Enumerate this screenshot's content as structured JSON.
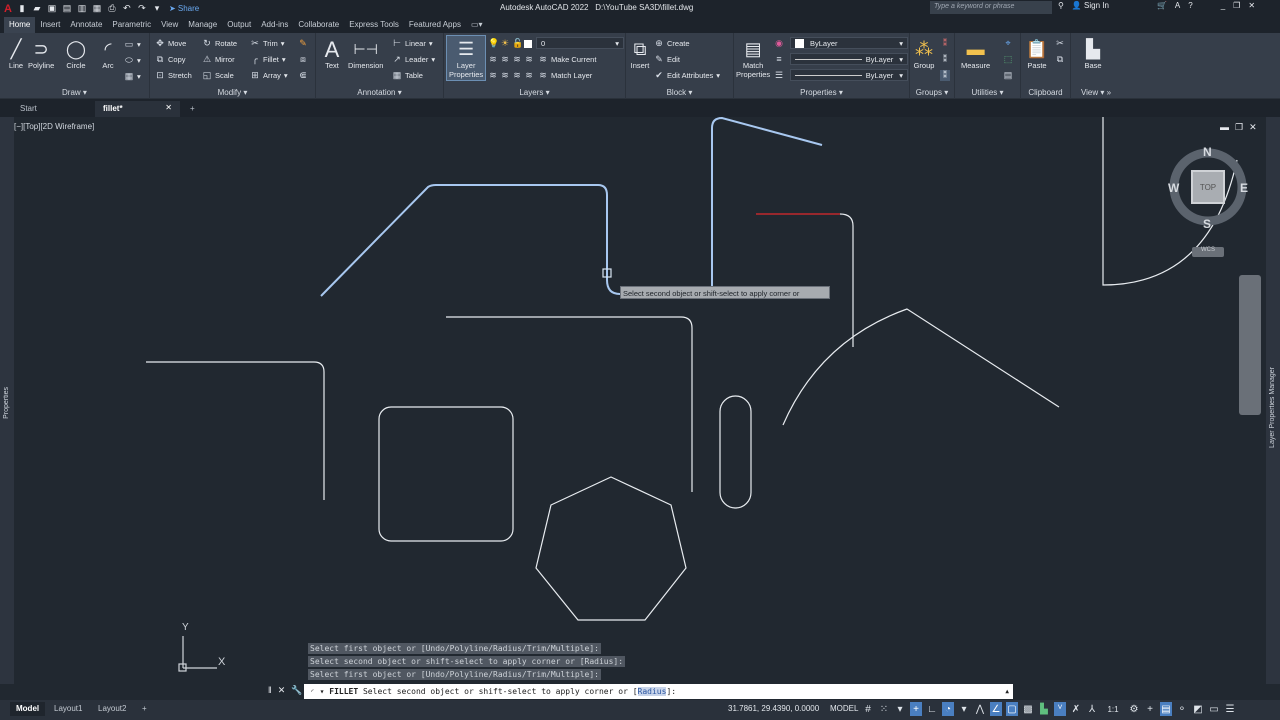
{
  "app": {
    "title": "Autodesk AutoCAD 2022",
    "file": "D:\\YouTube SA3D\\fillet.dwg",
    "share": "Share",
    "search_placeholder": "Type a keyword or phrase",
    "sign_in": "Sign In"
  },
  "ribbon_tabs": [
    "Home",
    "Insert",
    "Annotate",
    "Parametric",
    "View",
    "Manage",
    "Output",
    "Add-ins",
    "Collaborate",
    "Express Tools",
    "Featured Apps"
  ],
  "panels": {
    "draw": {
      "label": "Draw",
      "line": "Line",
      "polyline": "Polyline",
      "circle": "Circle",
      "arc": "Arc"
    },
    "modify": {
      "label": "Modify",
      "move": "Move",
      "rotate": "Rotate",
      "trim": "Trim",
      "copy": "Copy",
      "mirror": "Mirror",
      "fillet": "Fillet",
      "stretch": "Stretch",
      "scale": "Scale",
      "array": "Array"
    },
    "annotation": {
      "label": "Annotation",
      "text": "Text",
      "dimension": "Dimension",
      "linear": "Linear",
      "leader": "Leader",
      "table": "Table"
    },
    "layers": {
      "label": "Layers",
      "layer_properties_1": "Layer",
      "layer_properties_2": "Properties",
      "current_layer": "0",
      "make_current": "Make Current",
      "match_layer": "Match Layer"
    },
    "block": {
      "label": "Block",
      "insert": "Insert",
      "create": "Create",
      "edit": "Edit",
      "edit_attributes": "Edit Attributes"
    },
    "properties": {
      "label": "Properties",
      "match_1": "Match",
      "match_2": "Properties",
      "color": "ByLayer",
      "linetype": "ByLayer",
      "lineweight": "ByLayer"
    },
    "groups": {
      "label": "Groups",
      "group": "Group"
    },
    "utilities": {
      "label": "Utilities",
      "measure": "Measure"
    },
    "clipboard": {
      "label": "Clipboard",
      "paste": "Paste"
    },
    "view": {
      "label": "View",
      "base": "Base"
    }
  },
  "doc_tabs": {
    "start": "Start",
    "active": "fillet*"
  },
  "viewport": {
    "label": "[−][Top][2D Wireframe]"
  },
  "side_palettes": {
    "left": "Properties",
    "right": "Layer Properties Manager"
  },
  "viewcube": {
    "n": "N",
    "s": "S",
    "e": "E",
    "w": "W",
    "face": "TOP",
    "wcs": "WCS"
  },
  "tooltip": "Select second object or shift-select to apply corner or",
  "command_history": [
    "Select first object or [Undo/Polyline/Radius/Trim/Multiple]:",
    "Select second object or shift-select to apply corner or [Radius]:",
    "Select first object or [Undo/Polyline/Radius/Trim/Multiple]:"
  ],
  "command_line": {
    "command": "FILLET",
    "prompt_pre": " Select second object or shift-select to apply corner or [",
    "option": "Radius",
    "prompt_post": "]:"
  },
  "ucs": {
    "x": "X",
    "y": "Y"
  },
  "layout_tabs": [
    "Model",
    "Layout1",
    "Layout2"
  ],
  "status": {
    "coords": "31.7861, 29.4390, 0.0000",
    "space": "MODEL",
    "scale": "1:1"
  }
}
